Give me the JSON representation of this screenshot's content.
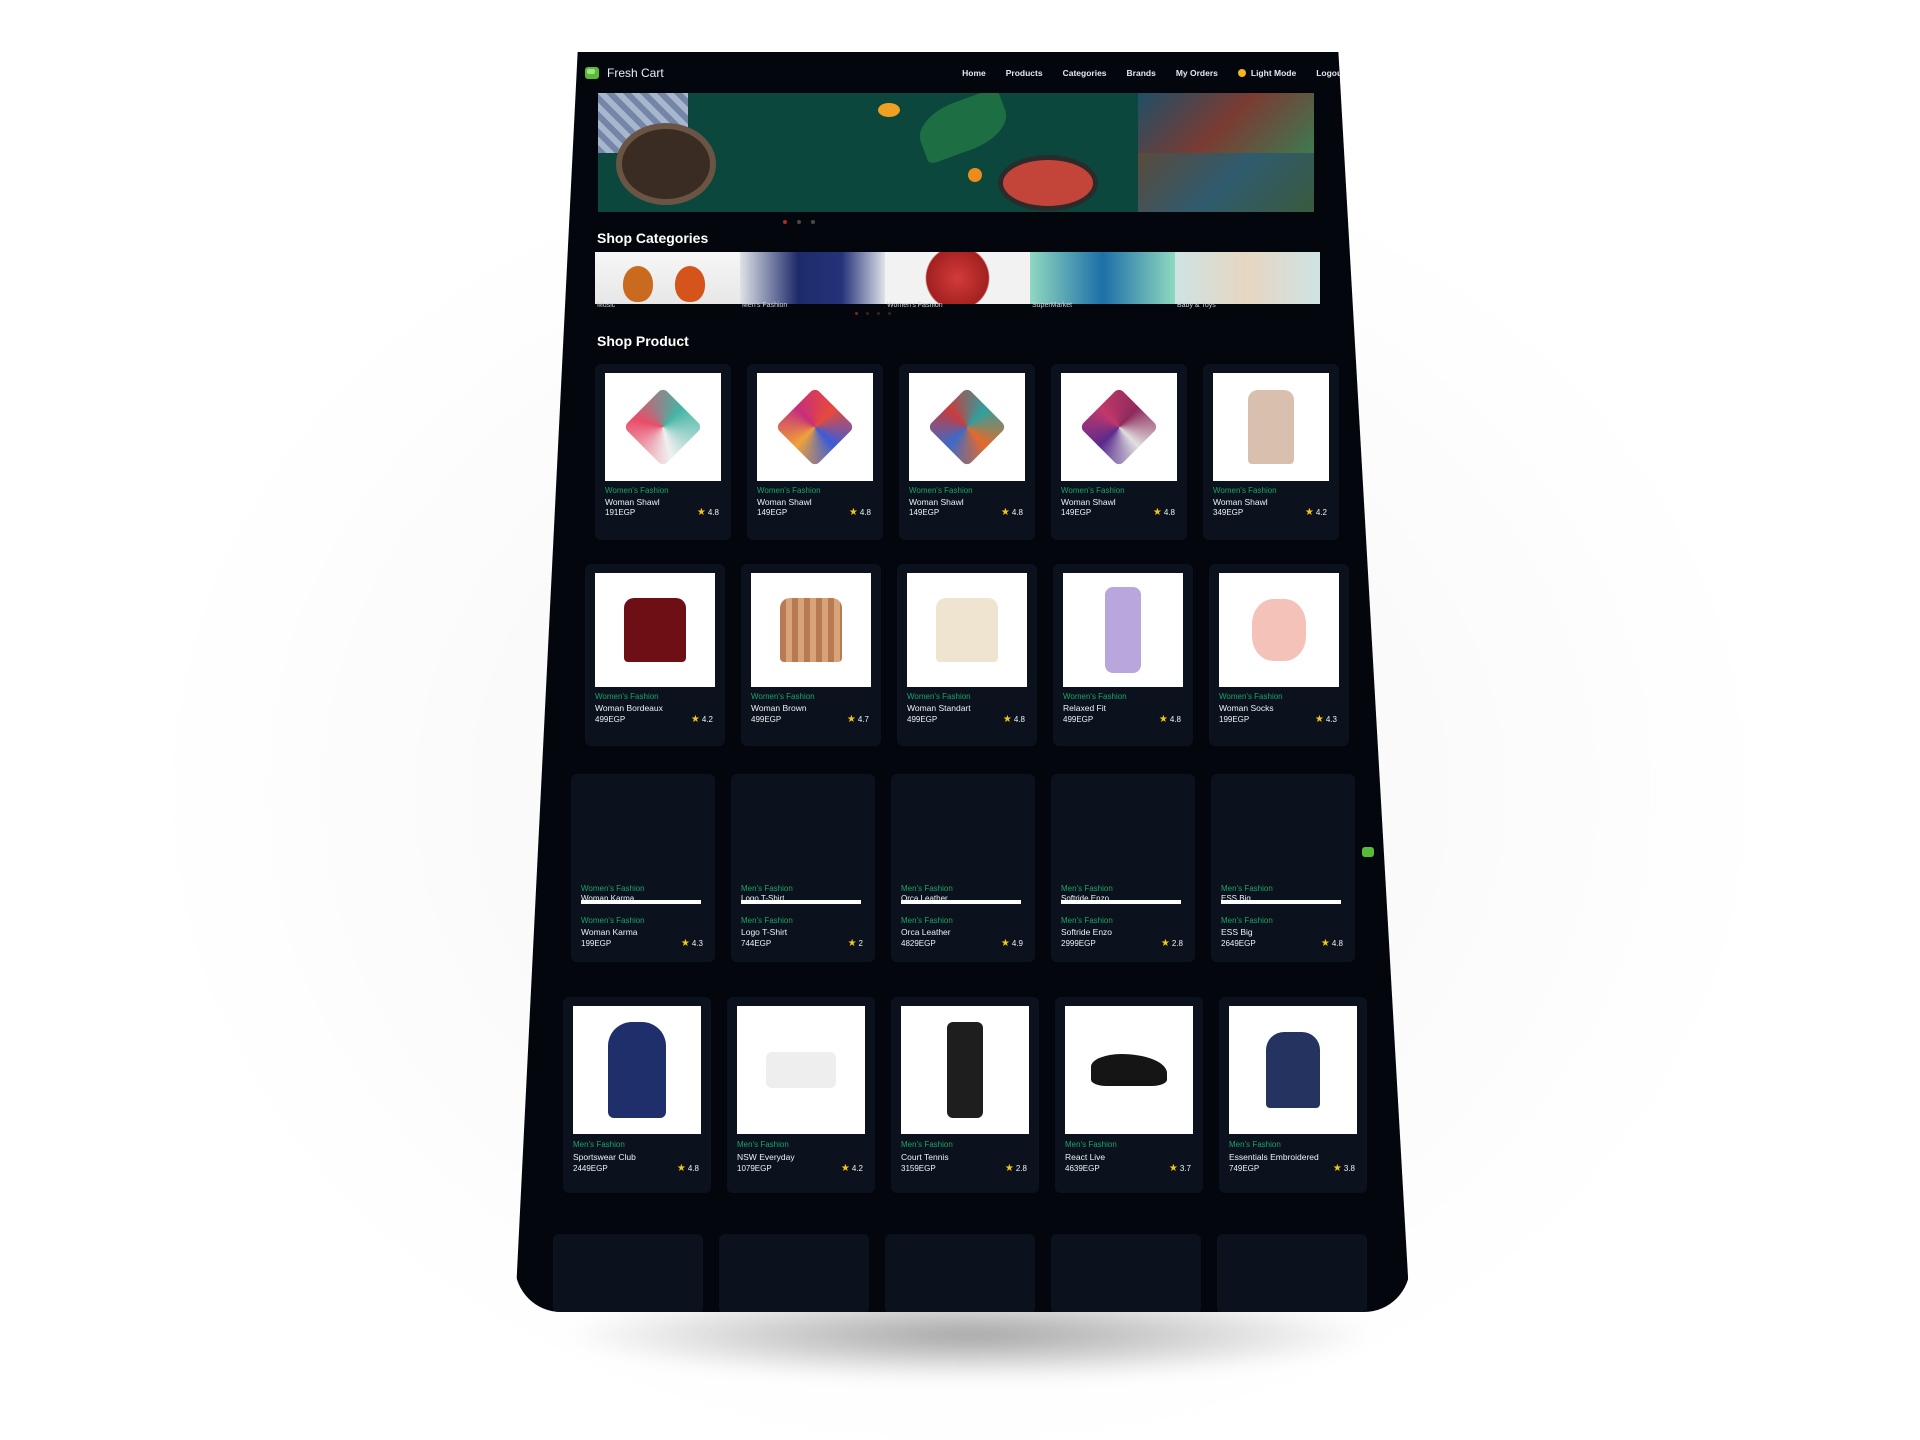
{
  "brand": {
    "name": "Fresh Cart",
    "icon": "cart-icon"
  },
  "nav": {
    "links": [
      "Home",
      "Products",
      "Categories",
      "Brands",
      "My Orders"
    ],
    "mode_label": "Light Mode",
    "logout_label": "Logout"
  },
  "sections": {
    "categories_title": "Shop Categories",
    "products_title": "Shop Product"
  },
  "categories": [
    {
      "label": "Music"
    },
    {
      "label": "Men's Fashion"
    },
    {
      "label": "Women's Fashion"
    },
    {
      "label": "SuperMarket"
    },
    {
      "label": "Baby & Toys"
    }
  ],
  "products": {
    "row1": [
      {
        "category": "Women's Fashion",
        "name": "Woman Shawl",
        "price": "191EGP",
        "rating": "4.8"
      },
      {
        "category": "Women's Fashion",
        "name": "Woman Shawl",
        "price": "149EGP",
        "rating": "4.8"
      },
      {
        "category": "Women's Fashion",
        "name": "Woman Shawl",
        "price": "149EGP",
        "rating": "4.8"
      },
      {
        "category": "Women's Fashion",
        "name": "Woman Shawl",
        "price": "149EGP",
        "rating": "4.8"
      },
      {
        "category": "Women's Fashion",
        "name": "Woman Shawl",
        "price": "349EGP",
        "rating": "4.2"
      }
    ],
    "row2": [
      {
        "category": "Women's Fashion",
        "name": "Woman Bordeaux",
        "price": "499EGP",
        "rating": "4.2"
      },
      {
        "category": "Women's Fashion",
        "name": "Woman Brown",
        "price": "499EGP",
        "rating": "4.7"
      },
      {
        "category": "Women's Fashion",
        "name": "Woman Standart",
        "price": "499EGP",
        "rating": "4.8"
      },
      {
        "category": "Women's Fashion",
        "name": "Relaxed Fit",
        "price": "499EGP",
        "rating": "4.8"
      },
      {
        "category": "Women's Fashion",
        "name": "Woman Socks",
        "price": "199EGP",
        "rating": "4.3"
      }
    ],
    "row3": [
      {
        "category": "Women's Fashion",
        "name": "Woman Karma",
        "price": "199EGP",
        "rating": "4.3"
      },
      {
        "category": "Men's Fashion",
        "name": "Logo T-Shirt",
        "price": "744EGP",
        "rating": "2"
      },
      {
        "category": "Men's Fashion",
        "name": "Orca Leather",
        "price": "4829EGP",
        "rating": "4.9"
      },
      {
        "category": "Men's Fashion",
        "name": "Softride Enzo",
        "price": "2999EGP",
        "rating": "2.8"
      },
      {
        "category": "Men's Fashion",
        "name": "ESS Big",
        "price": "2649EGP",
        "rating": "4.8"
      }
    ],
    "row4": [
      {
        "category": "Men's Fashion",
        "name": "Sportswear Club",
        "price": "2449EGP",
        "rating": "4.8"
      },
      {
        "category": "Men's Fashion",
        "name": "NSW Everyday",
        "price": "1079EGP",
        "rating": "4.2"
      },
      {
        "category": "Men's Fashion",
        "name": "Court Tennis",
        "price": "3159EGP",
        "rating": "2.8"
      },
      {
        "category": "Men's Fashion",
        "name": "React Live",
        "price": "4639EGP",
        "rating": "3.7"
      },
      {
        "category": "Men's Fashion",
        "name": "Essentials Embroidered",
        "price": "749EGP",
        "rating": "3.8"
      }
    ]
  },
  "colors": {
    "background": "#03060c",
    "card": "#0b121d",
    "accent": "#19a36a",
    "star": "#f5c518"
  }
}
